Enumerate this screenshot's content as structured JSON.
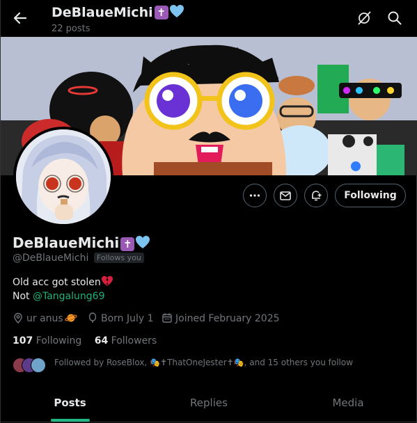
{
  "header": {
    "title": "DeBlaueMichi",
    "emoji_cross": "✝",
    "post_count": "22 posts"
  },
  "profile": {
    "display_name": "DeBlaueMichi",
    "handle": "@DeBlaueMichi",
    "follows_you_badge": "Follows you",
    "bio_line1": "Old acc got stolen",
    "bio_line2_prefix": "Not ",
    "bio_mention": "@Tangalung69",
    "location": "ur anus",
    "birth": "Born July 1",
    "joined": "Joined February 2025",
    "following_count": "107",
    "following_label": "Following",
    "followers_count": "64",
    "followers_label": "Followers",
    "followed_by": "Followed by RoseBlox, 🎭✝ThatOneJester✝🎭, and 15 others you follow"
  },
  "actions": {
    "follow_button": "Following"
  },
  "tabs": [
    {
      "label": "Posts",
      "active": true
    },
    {
      "label": "Replies",
      "active": false
    },
    {
      "label": "Media",
      "active": false
    }
  ],
  "colors": {
    "accent": "#1d9bf0",
    "tab_indicator": "#22b585",
    "mention": "#20b27a",
    "cross_emoji_bg": "#9b59b6",
    "heart": "#7cc3f0"
  }
}
